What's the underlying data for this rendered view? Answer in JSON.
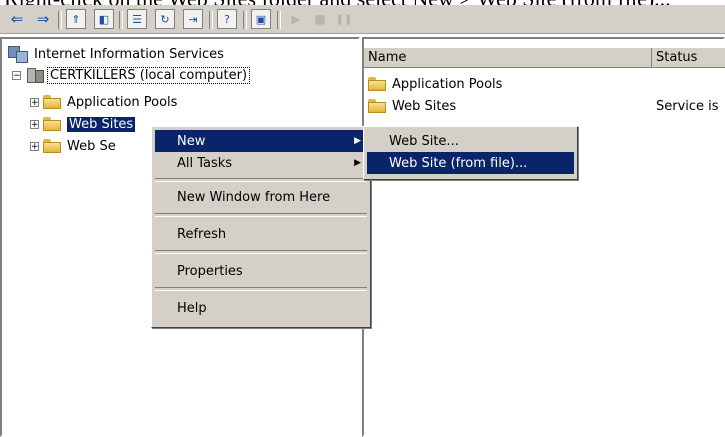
{
  "caption": "Right-click on the Web Sites folder and select New > Web Site (from file)...",
  "toolbar": {
    "buttons": [
      {
        "icon": "back-arrow-icon",
        "glyph": "⇐"
      },
      {
        "icon": "forward-arrow-icon",
        "glyph": "⇒"
      },
      {
        "icon": "up-level-icon",
        "glyph": "⇑"
      },
      {
        "icon": "show-hide-tree-icon",
        "glyph": "◧"
      },
      {
        "icon": "properties-icon",
        "glyph": "☰"
      },
      {
        "icon": "refresh-icon",
        "glyph": "↻"
      },
      {
        "icon": "export-list-icon",
        "glyph": "⇥"
      },
      {
        "icon": "help-icon",
        "glyph": "?"
      },
      {
        "icon": "computer-icon",
        "glyph": "▣"
      },
      {
        "icon": "play-icon",
        "glyph": "▶"
      },
      {
        "icon": "stop-icon",
        "glyph": "■"
      },
      {
        "icon": "pause-icon",
        "glyph": "❚❚"
      }
    ]
  },
  "tree": {
    "root": "Internet Information Services",
    "computer": "CERTKILLERS (local computer)",
    "items": [
      {
        "label": "Application Pools"
      },
      {
        "label": "Web Sites"
      },
      {
        "label": "Web Se"
      }
    ]
  },
  "list": {
    "columns": [
      "Name",
      "Status"
    ],
    "rows": [
      {
        "name": "Application Pools",
        "status": ""
      },
      {
        "name": "Web Sites",
        "status": "Service is"
      }
    ]
  },
  "context_menu": {
    "items": [
      {
        "label": "New",
        "submenu": true
      },
      {
        "label": "All Tasks",
        "submenu": true
      },
      {
        "label": "New Window from Here"
      },
      {
        "label": "Refresh"
      },
      {
        "label": "Properties"
      },
      {
        "label": "Help"
      }
    ]
  },
  "submenu": {
    "items": [
      {
        "label": "Web Site..."
      },
      {
        "label": "Web Site (from file)..."
      }
    ]
  },
  "colors": {
    "highlight": "#0a246a",
    "window": "#d4d0c8"
  }
}
